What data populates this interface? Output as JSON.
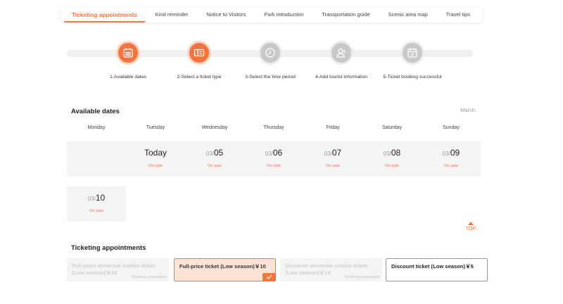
{
  "tabs": [
    {
      "label": "Ticketing appointments",
      "active": true
    },
    {
      "label": "Kind reminder",
      "active": false
    },
    {
      "label": "Notice to Visitors",
      "active": false
    },
    {
      "label": "Park introduction",
      "active": false
    },
    {
      "label": "Transportation guide",
      "active": false
    },
    {
      "label": "Scenic area map",
      "active": false
    },
    {
      "label": "Travel tips",
      "active": false
    }
  ],
  "steps": [
    {
      "label": "1-Available dates",
      "icon": "calendar-icon",
      "done": true
    },
    {
      "label": "2-Select a ticket type",
      "icon": "ticket-icon",
      "done": true
    },
    {
      "label": "3-Select the time period",
      "icon": "clock-icon",
      "done": false
    },
    {
      "label": "4-Add tourist information",
      "icon": "user-icon",
      "done": false
    },
    {
      "label": "5-Ticket booking successful",
      "icon": "calendar-check-icon",
      "done": false
    }
  ],
  "available_dates": {
    "title": "Available dates",
    "month": "March",
    "weekdays": [
      "Monday",
      "Tuesday",
      "Wednesday",
      "Thursday",
      "Friday",
      "Saturday",
      "Sunday"
    ],
    "rows": [
      [
        {
          "prefix": "",
          "day": "",
          "status": ""
        },
        {
          "prefix": "",
          "day": "Today",
          "status": "On sale"
        },
        {
          "prefix": "03/",
          "day": "05",
          "status": "On sale"
        },
        {
          "prefix": "03/",
          "day": "06",
          "status": "On sale"
        },
        {
          "prefix": "03/",
          "day": "07",
          "status": "On sale"
        },
        {
          "prefix": "03/",
          "day": "08",
          "status": "On sale"
        },
        {
          "prefix": "03/",
          "day": "09",
          "status": "On sale"
        }
      ],
      [
        {
          "prefix": "03/",
          "day": "10",
          "status": "On sale"
        }
      ]
    ]
  },
  "top_label": "TOP",
  "ticketing": {
    "title": "Ticketing appointments",
    "tickets": [
      {
        "name": "Full-price universal combo ticket (Low season)￥28",
        "note": "Ticketing unavailable",
        "state": "unavailable"
      },
      {
        "name": "Full-price ticket (Low season)￥10",
        "note": "",
        "state": "selected"
      },
      {
        "name": "Discount universal combo ticket (Low season)￥14",
        "note": "Ticketing unavailable",
        "state": "unavailable"
      },
      {
        "name": "Discount ticket (Low season)￥5",
        "note": "",
        "state": "normal"
      }
    ]
  },
  "colors": {
    "accent": "#f3743f",
    "inactive_step": "#c8c8c8",
    "cell_bg": "#f4f4f4"
  }
}
